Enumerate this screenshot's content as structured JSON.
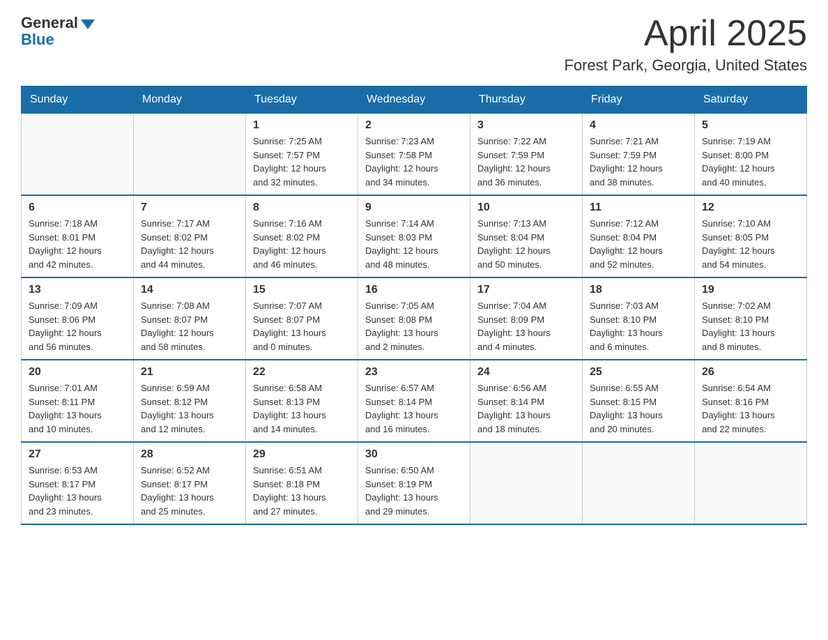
{
  "logo": {
    "general": "General",
    "blue": "Blue"
  },
  "title": "April 2025",
  "subtitle": "Forest Park, Georgia, United States",
  "days_of_week": [
    "Sunday",
    "Monday",
    "Tuesday",
    "Wednesday",
    "Thursday",
    "Friday",
    "Saturday"
  ],
  "weeks": [
    [
      {
        "day": "",
        "info": ""
      },
      {
        "day": "",
        "info": ""
      },
      {
        "day": "1",
        "info": "Sunrise: 7:25 AM\nSunset: 7:57 PM\nDaylight: 12 hours\nand 32 minutes."
      },
      {
        "day": "2",
        "info": "Sunrise: 7:23 AM\nSunset: 7:58 PM\nDaylight: 12 hours\nand 34 minutes."
      },
      {
        "day": "3",
        "info": "Sunrise: 7:22 AM\nSunset: 7:59 PM\nDaylight: 12 hours\nand 36 minutes."
      },
      {
        "day": "4",
        "info": "Sunrise: 7:21 AM\nSunset: 7:59 PM\nDaylight: 12 hours\nand 38 minutes."
      },
      {
        "day": "5",
        "info": "Sunrise: 7:19 AM\nSunset: 8:00 PM\nDaylight: 12 hours\nand 40 minutes."
      }
    ],
    [
      {
        "day": "6",
        "info": "Sunrise: 7:18 AM\nSunset: 8:01 PM\nDaylight: 12 hours\nand 42 minutes."
      },
      {
        "day": "7",
        "info": "Sunrise: 7:17 AM\nSunset: 8:02 PM\nDaylight: 12 hours\nand 44 minutes."
      },
      {
        "day": "8",
        "info": "Sunrise: 7:16 AM\nSunset: 8:02 PM\nDaylight: 12 hours\nand 46 minutes."
      },
      {
        "day": "9",
        "info": "Sunrise: 7:14 AM\nSunset: 8:03 PM\nDaylight: 12 hours\nand 48 minutes."
      },
      {
        "day": "10",
        "info": "Sunrise: 7:13 AM\nSunset: 8:04 PM\nDaylight: 12 hours\nand 50 minutes."
      },
      {
        "day": "11",
        "info": "Sunrise: 7:12 AM\nSunset: 8:04 PM\nDaylight: 12 hours\nand 52 minutes."
      },
      {
        "day": "12",
        "info": "Sunrise: 7:10 AM\nSunset: 8:05 PM\nDaylight: 12 hours\nand 54 minutes."
      }
    ],
    [
      {
        "day": "13",
        "info": "Sunrise: 7:09 AM\nSunset: 8:06 PM\nDaylight: 12 hours\nand 56 minutes."
      },
      {
        "day": "14",
        "info": "Sunrise: 7:08 AM\nSunset: 8:07 PM\nDaylight: 12 hours\nand 58 minutes."
      },
      {
        "day": "15",
        "info": "Sunrise: 7:07 AM\nSunset: 8:07 PM\nDaylight: 13 hours\nand 0 minutes."
      },
      {
        "day": "16",
        "info": "Sunrise: 7:05 AM\nSunset: 8:08 PM\nDaylight: 13 hours\nand 2 minutes."
      },
      {
        "day": "17",
        "info": "Sunrise: 7:04 AM\nSunset: 8:09 PM\nDaylight: 13 hours\nand 4 minutes."
      },
      {
        "day": "18",
        "info": "Sunrise: 7:03 AM\nSunset: 8:10 PM\nDaylight: 13 hours\nand 6 minutes."
      },
      {
        "day": "19",
        "info": "Sunrise: 7:02 AM\nSunset: 8:10 PM\nDaylight: 13 hours\nand 8 minutes."
      }
    ],
    [
      {
        "day": "20",
        "info": "Sunrise: 7:01 AM\nSunset: 8:11 PM\nDaylight: 13 hours\nand 10 minutes."
      },
      {
        "day": "21",
        "info": "Sunrise: 6:59 AM\nSunset: 8:12 PM\nDaylight: 13 hours\nand 12 minutes."
      },
      {
        "day": "22",
        "info": "Sunrise: 6:58 AM\nSunset: 8:13 PM\nDaylight: 13 hours\nand 14 minutes."
      },
      {
        "day": "23",
        "info": "Sunrise: 6:57 AM\nSunset: 8:14 PM\nDaylight: 13 hours\nand 16 minutes."
      },
      {
        "day": "24",
        "info": "Sunrise: 6:56 AM\nSunset: 8:14 PM\nDaylight: 13 hours\nand 18 minutes."
      },
      {
        "day": "25",
        "info": "Sunrise: 6:55 AM\nSunset: 8:15 PM\nDaylight: 13 hours\nand 20 minutes."
      },
      {
        "day": "26",
        "info": "Sunrise: 6:54 AM\nSunset: 8:16 PM\nDaylight: 13 hours\nand 22 minutes."
      }
    ],
    [
      {
        "day": "27",
        "info": "Sunrise: 6:53 AM\nSunset: 8:17 PM\nDaylight: 13 hours\nand 23 minutes."
      },
      {
        "day": "28",
        "info": "Sunrise: 6:52 AM\nSunset: 8:17 PM\nDaylight: 13 hours\nand 25 minutes."
      },
      {
        "day": "29",
        "info": "Sunrise: 6:51 AM\nSunset: 8:18 PM\nDaylight: 13 hours\nand 27 minutes."
      },
      {
        "day": "30",
        "info": "Sunrise: 6:50 AM\nSunset: 8:19 PM\nDaylight: 13 hours\nand 29 minutes."
      },
      {
        "day": "",
        "info": ""
      },
      {
        "day": "",
        "info": ""
      },
      {
        "day": "",
        "info": ""
      }
    ]
  ]
}
